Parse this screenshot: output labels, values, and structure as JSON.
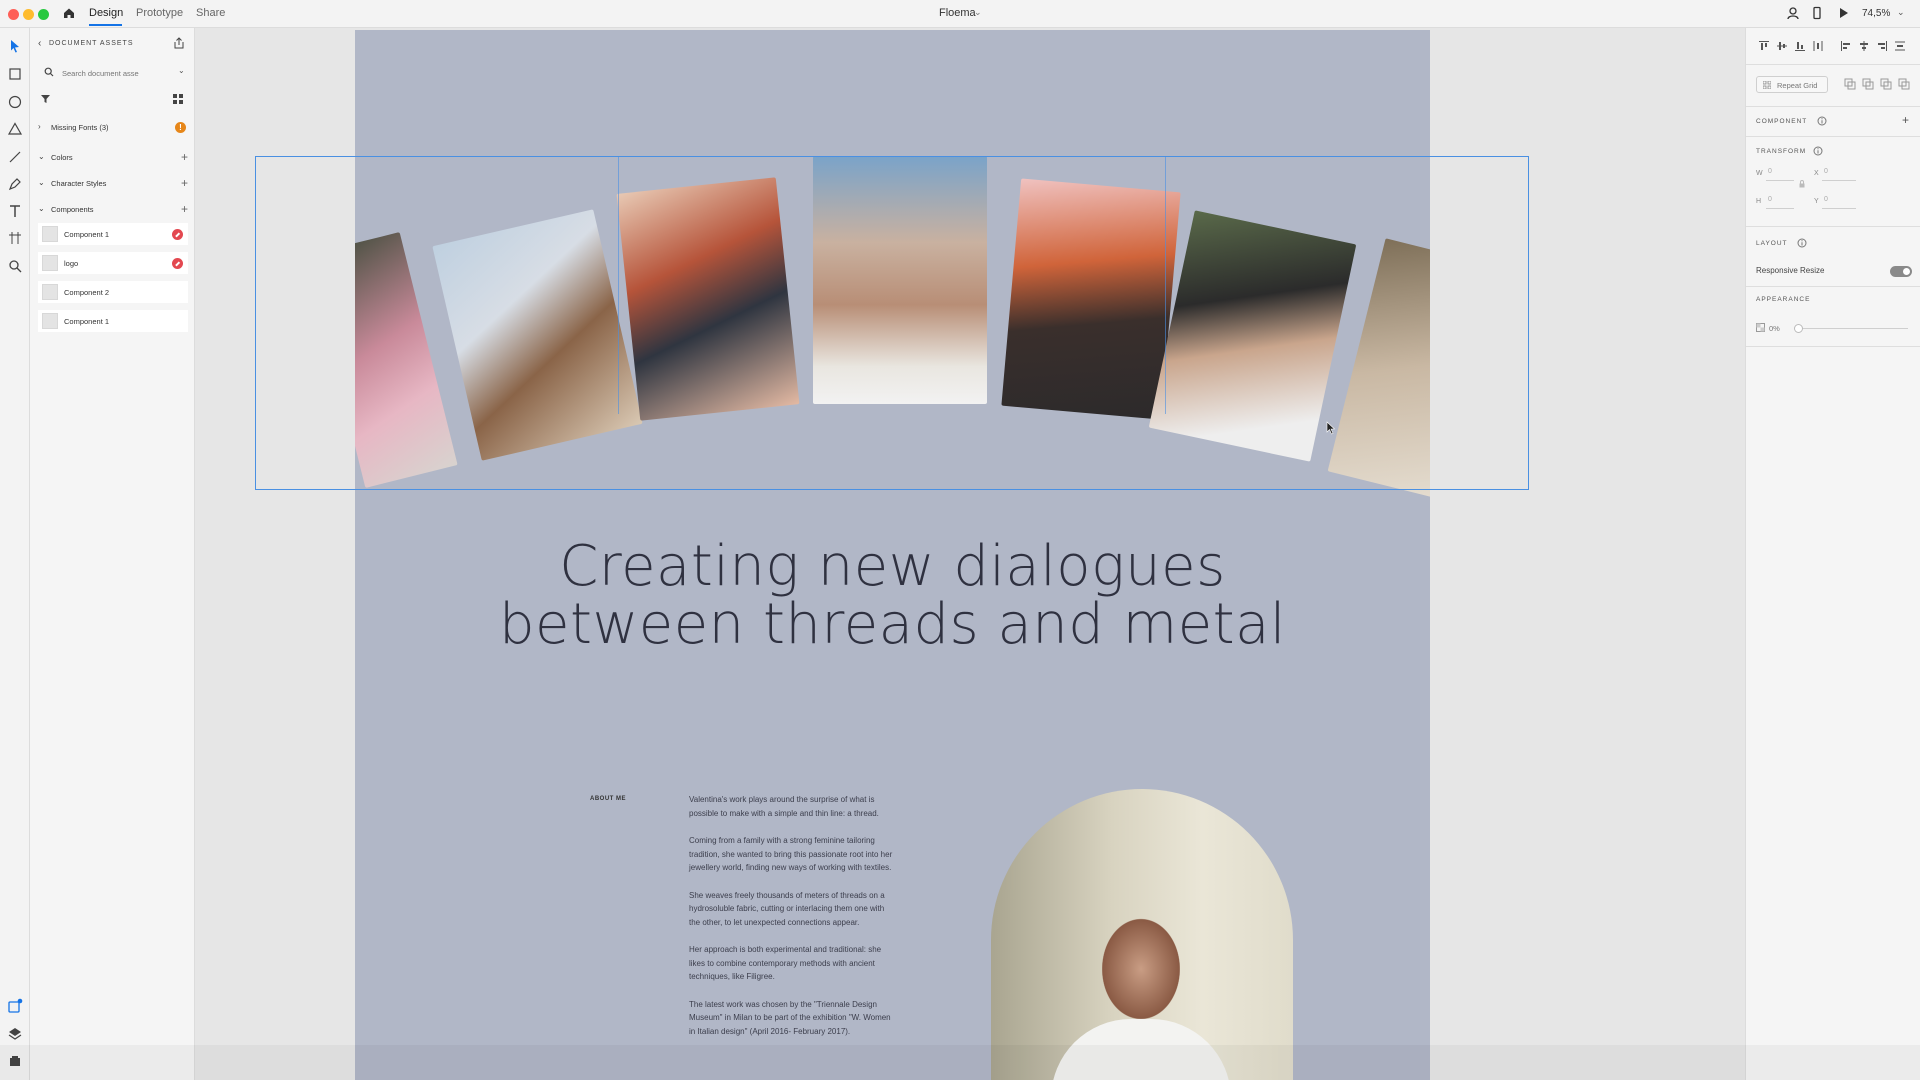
{
  "topbar": {
    "tabs": [
      {
        "label": "Design",
        "active": true
      },
      {
        "label": "Prototype",
        "active": false
      },
      {
        "label": "Share",
        "active": false
      }
    ],
    "doc_title": "Floema",
    "zoom": "74,5%"
  },
  "assets": {
    "title": "DOCUMENT ASSETS",
    "search_placeholder": "Search document asse",
    "sections": {
      "missing_fonts": "Missing Fonts (3)",
      "missing_fonts_badge": "!",
      "colors": "Colors",
      "character_styles": "Character Styles",
      "components": "Components"
    },
    "components": [
      {
        "label": "Component 1",
        "error": true
      },
      {
        "label": "logo",
        "error": true
      },
      {
        "label": "Component 2",
        "error": false
      },
      {
        "label": "Component 1",
        "error": false
      }
    ]
  },
  "artboard": {
    "background": "#b1b7c7",
    "headline": [
      "Creating new dialogues",
      "between threads and metal"
    ],
    "about_label": "ABOUT ME",
    "about_paragraphs": [
      "Valentina's work plays around the surprise of what is possible to make with a simple and thin line: a thread.",
      "Coming from a family with a strong feminine tailoring tradition, she wanted to bring this passionate root into her jewellery world, finding new ways of working with textiles.",
      "She weaves freely thousands of meters of threads on a hydrosoluble fabric, cutting or interlacing them one with the other, to let unexpected connections appear.",
      "Her approach is both experimental and traditional: she likes to combine contemporary methods with ancient techniques, like Filigree.",
      "The latest work was chosen by the \"Triennale Design Museum\" in Milan to be part of the exhibition \"W. Women in Italian design\" (April 2016- February 2017)."
    ]
  },
  "properties": {
    "repeat_grid": "Repeat Grid",
    "component_heading": "COMPONENT",
    "transform_heading": "TRANSFORM",
    "w_label": "W",
    "w_value": "0",
    "x_label": "X",
    "x_value": "0",
    "h_label": "H",
    "h_value": "0",
    "y_label": "Y",
    "y_value": "0",
    "layout_heading": "LAYOUT",
    "responsive_resize": "Responsive Resize",
    "responsive_resize_on": true,
    "appearance_heading": "APPEARANCE",
    "opacity": "0%"
  },
  "colors": {
    "accent": "#1473e6",
    "selection": "#4a90e2",
    "error_badge": "#e34850",
    "warning_badge": "#e68619"
  }
}
